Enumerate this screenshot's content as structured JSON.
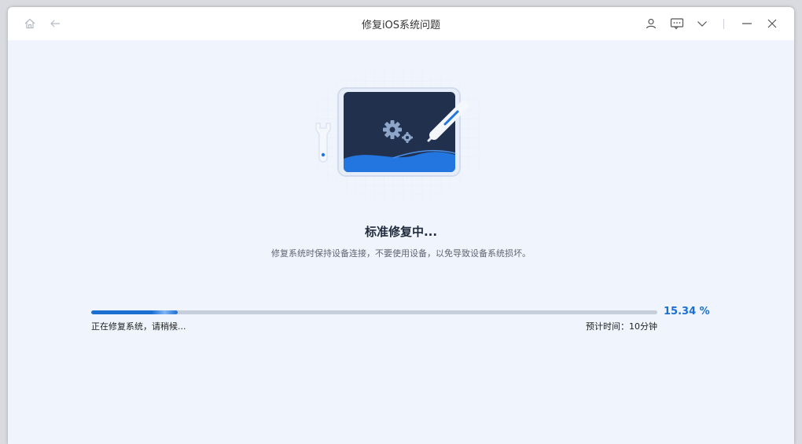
{
  "window": {
    "title": "修复iOS系统问题",
    "icons": {
      "home": "home-icon",
      "back": "back-arrow-icon",
      "account": "user-icon",
      "feedback": "message-icon",
      "menu": "chevron-down-icon",
      "minimize": "minimize-icon",
      "close": "close-icon"
    }
  },
  "main": {
    "heading": "标准修复中...",
    "subtitle": "修复系统时保持设备连接，不要使用设备，以免导致设备系统损坏。",
    "illustration": "tablet-with-gears-and-tools"
  },
  "progress": {
    "percent_label": "15.34 %",
    "percent_value": 0.1534,
    "status_text": "正在修复系统，请稍候...",
    "eta_text": "预计时间：10分钟"
  },
  "colors": {
    "accent": "#1b6fd1",
    "background": "#eff4fd",
    "track": "#c7cedb",
    "screen": "#1f2f4d"
  }
}
